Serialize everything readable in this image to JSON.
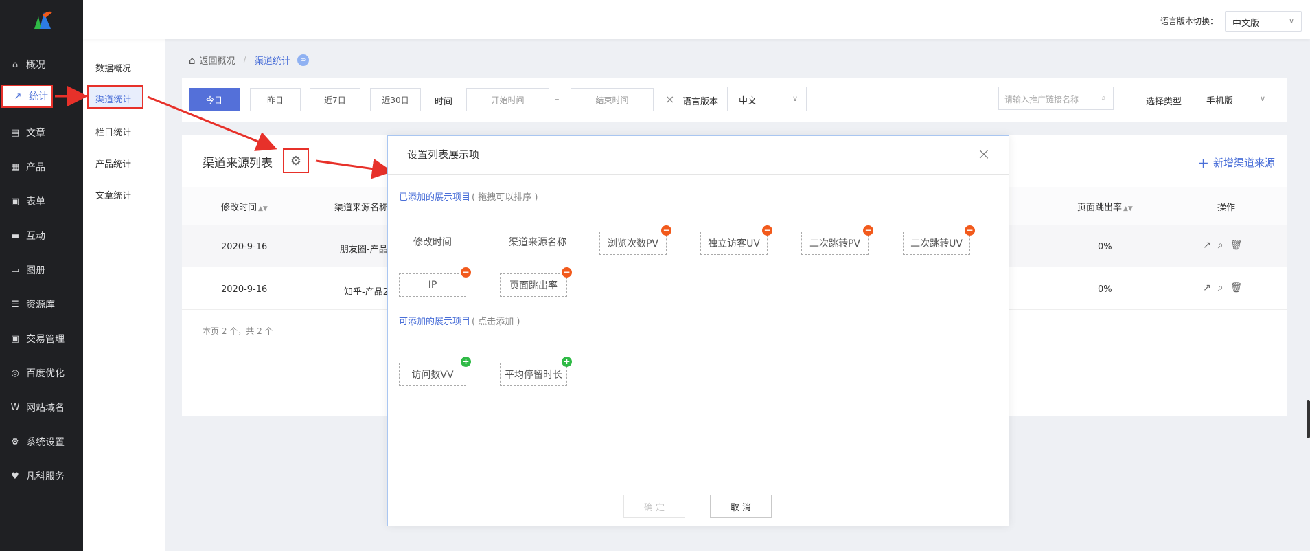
{
  "topbar": {
    "lang_label": "语言版本切换：",
    "lang_value": "中文版"
  },
  "nav": {
    "items": [
      {
        "label": "概况",
        "icon": "home-icon"
      },
      {
        "label": "统计",
        "icon": "chart-icon"
      },
      {
        "label": "文章",
        "icon": "document-icon"
      },
      {
        "label": "产品",
        "icon": "grid-icon"
      },
      {
        "label": "表单",
        "icon": "clipboard-icon"
      },
      {
        "label": "互动",
        "icon": "chat-icon"
      },
      {
        "label": "图册",
        "icon": "image-icon"
      },
      {
        "label": "资源库",
        "icon": "database-icon"
      },
      {
        "label": "交易管理",
        "icon": "clipboard-icon"
      },
      {
        "label": "百度优化",
        "icon": "refresh-icon"
      },
      {
        "label": "网站域名",
        "icon": "w-icon"
      },
      {
        "label": "系统设置",
        "icon": "gear-icon"
      },
      {
        "label": "凡科服务",
        "icon": "heart-icon"
      }
    ]
  },
  "submenu": {
    "items": [
      "数据概况",
      "渠道统计",
      "栏目统计",
      "产品统计",
      "文章统计"
    ]
  },
  "breadcrumb": {
    "back": "返回概况",
    "separator": "/",
    "current": "渠道统计"
  },
  "filter": {
    "today": "今日",
    "yesterday": "昨日",
    "last7": "近7日",
    "last30": "近30日",
    "time_label": "时间",
    "start_placeholder": "开始时间",
    "range_sep": "–",
    "end_placeholder": "结束时间",
    "clear": "×",
    "lang_label": "语言版本",
    "lang_value": "中文",
    "search_placeholder": "请输入推广链接名称",
    "type_label": "选择类型",
    "type_value": "手机版"
  },
  "list": {
    "title": "渠道来源列表",
    "add_button": "新增渠道来源",
    "columns": [
      "修改时间",
      "渠道来源名称",
      "页面跳出率",
      "操作"
    ],
    "rows": [
      {
        "time": "2020-9-16",
        "name": "朋友圈-产品",
        "bounce": "0%"
      },
      {
        "time": "2020-9-16",
        "name": "知乎-产品2",
        "bounce": "0%"
      }
    ],
    "pager": "本页 2 个，共 2 个"
  },
  "modal": {
    "title": "设置列表展示项",
    "close": "×",
    "added_title": "已添加的展示项目",
    "added_hint": "( 拖拽可以排序 )",
    "fixed_items": [
      "修改时间",
      "渠道来源名称"
    ],
    "added_items": [
      "浏览次数PV",
      "独立访客UV",
      "二次跳转PV",
      "二次跳转UV",
      "IP",
      "页面跳出率"
    ],
    "available_title": "可添加的展示项目",
    "available_hint": "( 点击添加 )",
    "available_items": [
      "访问数VV",
      "平均停留时长"
    ],
    "confirm": "确 定",
    "cancel": "取 消"
  },
  "colors": {
    "accent": "#4a6fd8",
    "primary_button": "#5470d9",
    "highlight_border": "#e7312a",
    "minus_badge": "#f25a1c",
    "plus_badge": "#2fba46",
    "nav_bg": "#1f2023"
  }
}
